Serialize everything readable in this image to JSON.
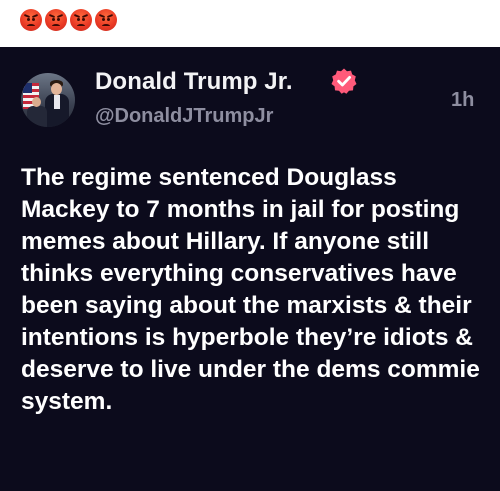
{
  "reaction_bar": {
    "emojis": [
      "angry-face-icon",
      "angry-face-icon",
      "angry-face-icon",
      "angry-face-icon"
    ],
    "emoji_color": "#ea3a25"
  },
  "post": {
    "author_name": "Donald Trump Jr.",
    "handle": "@DonaldJTrumpJr",
    "timestamp": "1h",
    "verified_icon": "verified-badge-icon",
    "verified_color": "#ff5a7a",
    "avatar_icon": "profile-photo-avatar",
    "text": "The regime sentenced Douglass Mackey to 7 months in jail for posting memes about Hillary. If anyone still thinks everything conservatives have been saying about the marxists & their intentions is hyperbole they’re idiots & deserve to live under the dems commie system.",
    "background_color": "#0c0b1c",
    "text_color": "#ffffff",
    "meta_color": "#8e8ea0"
  }
}
